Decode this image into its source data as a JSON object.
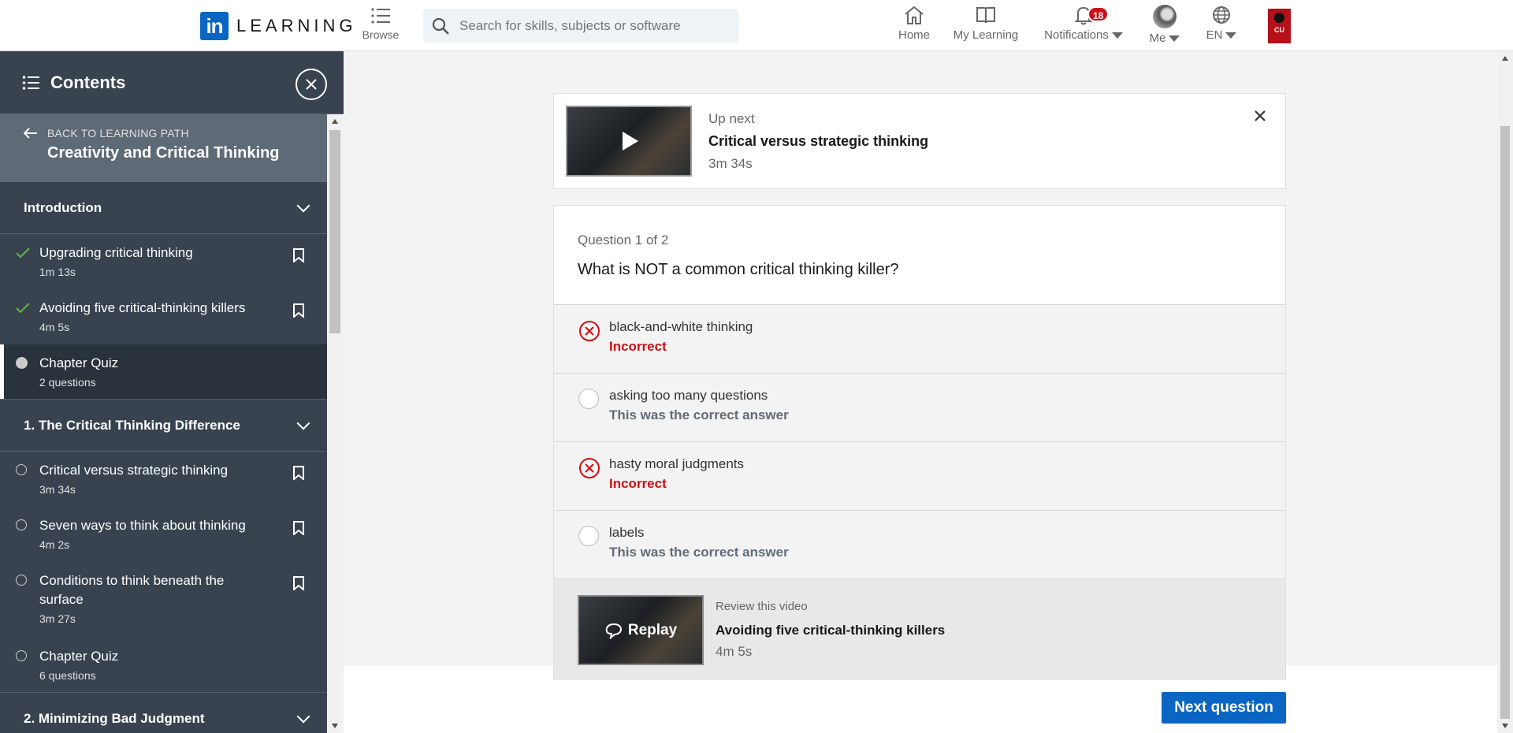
{
  "header": {
    "logo_mark": "in",
    "logo_text": "LEARNING",
    "browse_label": "Browse",
    "search_placeholder": "Search for skills, subjects or software",
    "nav": {
      "home": "Home",
      "my_learning": "My Learning",
      "notifications": "Notifications",
      "notifications_count": "18",
      "me": "Me",
      "language": "EN"
    },
    "org_logo_text": "CU"
  },
  "sidebar": {
    "title": "Contents",
    "back_label": "BACK TO LEARNING PATH",
    "path_title": "Creativity and Critical Thinking",
    "sections": [
      {
        "title": "Introduction",
        "items": [
          {
            "name": "Upgrading critical thinking",
            "duration": "1m 13s",
            "status": "done"
          },
          {
            "name": "Avoiding five critical-thinking killers",
            "duration": "4m 5s",
            "status": "done"
          },
          {
            "name": "Chapter Quiz",
            "duration": "2 questions",
            "status": "current"
          }
        ]
      },
      {
        "title": "1. The Critical Thinking Difference",
        "items": [
          {
            "name": "Critical versus strategic thinking",
            "duration": "3m 34s",
            "status": "todo"
          },
          {
            "name": "Seven ways to think about thinking",
            "duration": "4m 2s",
            "status": "todo"
          },
          {
            "name": "Conditions to think beneath the surface",
            "duration": "3m 27s",
            "status": "todo"
          },
          {
            "name": "Chapter Quiz",
            "duration": "6 questions",
            "status": "todo"
          }
        ]
      },
      {
        "title": "2. Minimizing Bad Judgment",
        "items": []
      }
    ]
  },
  "up_next": {
    "label": "Up next",
    "title": "Critical versus strategic thinking",
    "duration": "3m 34s"
  },
  "quiz": {
    "counter": "Question 1 of 2",
    "question": "What is NOT a common critical thinking killer?",
    "options": [
      {
        "text": "black-and-white thinking",
        "verdict": "Incorrect",
        "state": "incorrect"
      },
      {
        "text": "asking too many questions",
        "verdict": "This was the correct answer",
        "state": "correct"
      },
      {
        "text": "hasty moral judgments",
        "verdict": "Incorrect",
        "state": "incorrect"
      },
      {
        "text": "labels",
        "verdict": "This was the correct answer",
        "state": "correct"
      }
    ],
    "review": {
      "label": "Review this video",
      "replay_label": "Replay",
      "title": "Avoiding five critical-thinking killers",
      "duration": "4m 5s"
    },
    "next_button": "Next question"
  },
  "colors": {
    "brand": "#0a66c2",
    "incorrect": "#cc1016",
    "correct_text": "#5e6c7a",
    "success_check": "#5bb544",
    "sidebar_bg": "#38434f"
  }
}
